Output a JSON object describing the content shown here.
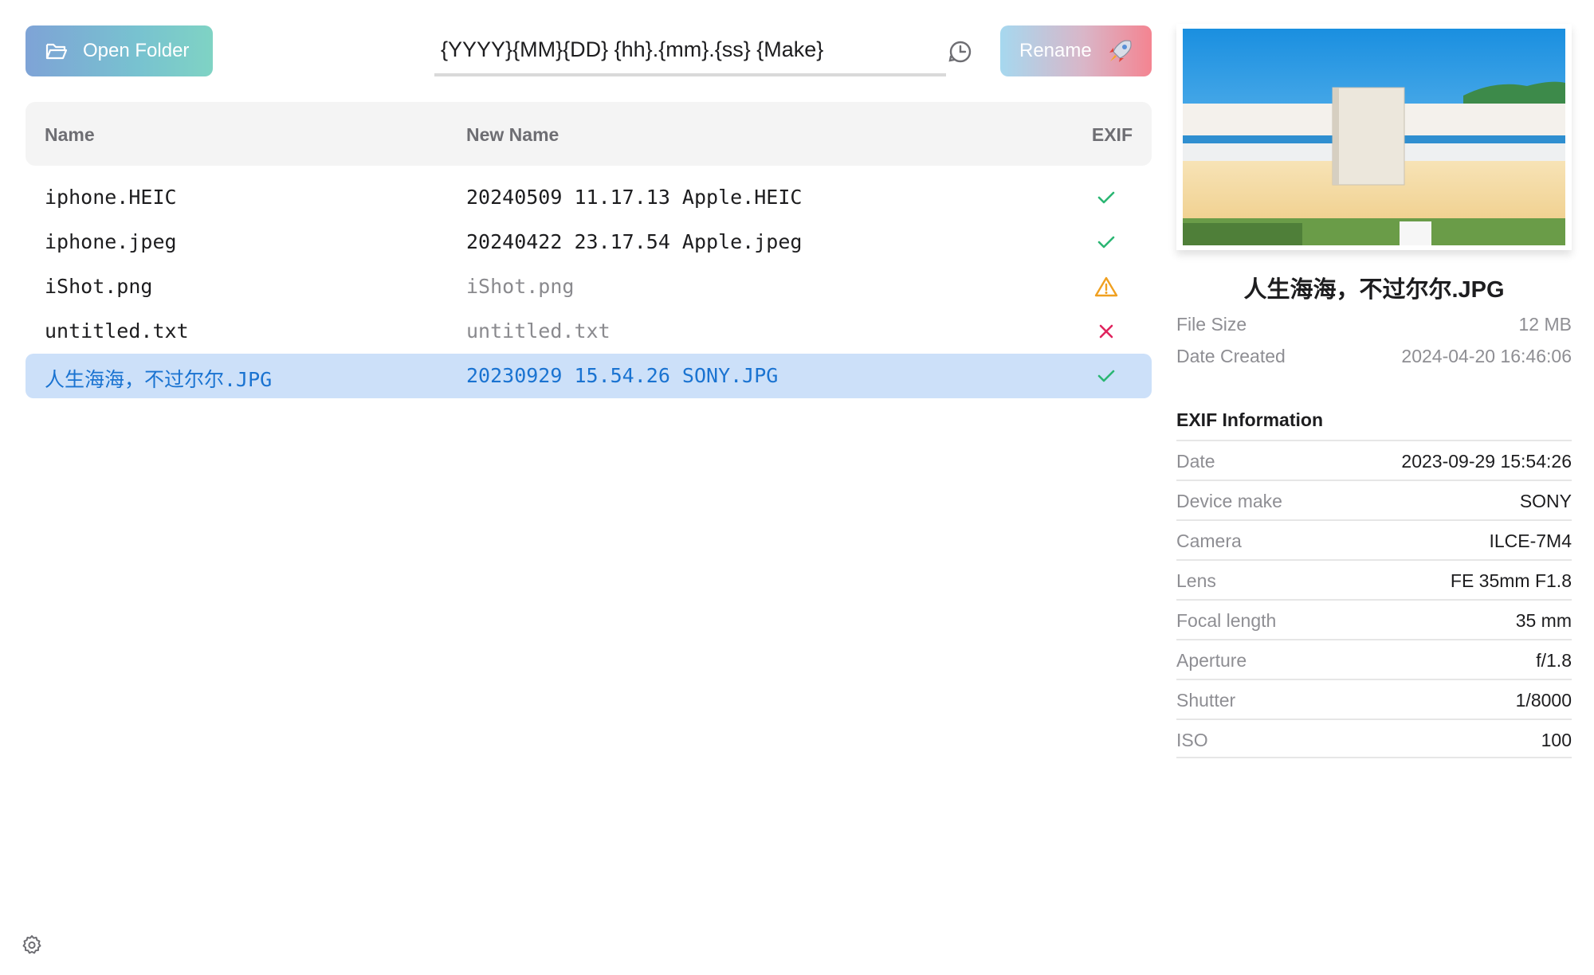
{
  "toolbar": {
    "open_folder_label": "Open Folder",
    "template_value": "{YYYY}{MM}{DD} {hh}.{mm}.{ss} {Make}",
    "rename_label": "Rename"
  },
  "table": {
    "headers": {
      "name": "Name",
      "new_name": "New Name",
      "exif": "EXIF"
    },
    "rows": [
      {
        "name": "iphone.HEIC",
        "new_name": "20240509 11.17.13 Apple.HEIC",
        "exif": "ok"
      },
      {
        "name": "iphone.jpeg",
        "new_name": "20240422 23.17.54 Apple.jpeg",
        "exif": "ok"
      },
      {
        "name": "iShot.png",
        "new_name": "iShot.png",
        "exif": "warning"
      },
      {
        "name": "untitled.txt",
        "new_name": "untitled.txt",
        "exif": "error"
      },
      {
        "name": "人生海海，不过尔尔.JPG",
        "new_name": "20230929 15.54.26 SONY.JPG",
        "exif": "ok",
        "selected": true
      }
    ]
  },
  "details": {
    "title": "人生海海，不过尔尔.JPG",
    "file_size_label": "File Size",
    "file_size": "12 MB",
    "date_created_label": "Date Created",
    "date_created": "2024-04-20 16:46:06",
    "exif_title": "EXIF Information",
    "exif": [
      {
        "label": "Date",
        "value": "2023-09-29 15:54:26"
      },
      {
        "label": "Device make",
        "value": "SONY"
      },
      {
        "label": "Camera",
        "value": "ILCE-7M4"
      },
      {
        "label": "Lens",
        "value": "FE 35mm F1.8"
      },
      {
        "label": "Focal length",
        "value": "35 mm"
      },
      {
        "label": "Aperture",
        "value": "f/1.8"
      },
      {
        "label": "Shutter",
        "value": "1/8000"
      },
      {
        "label": "ISO",
        "value": "100"
      }
    ]
  },
  "colors": {
    "ok": "#2bb673",
    "warning": "#f0a020",
    "error": "#e0245e",
    "selected_bg": "#cce0f9",
    "selected_text": "#1a73d1"
  },
  "icons": {
    "open_folder": "folder-open-icon",
    "history": "history-clock-icon",
    "rename": "rocket-icon",
    "settings": "gear-icon",
    "ok": "checkmark-icon",
    "warning": "warning-triangle-icon",
    "error": "cross-icon"
  }
}
